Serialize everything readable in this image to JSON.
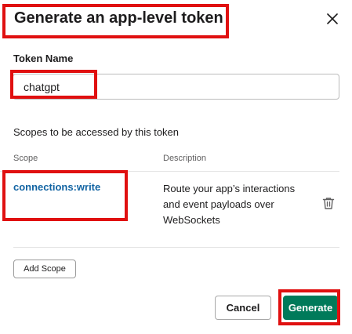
{
  "dialog": {
    "title": "Generate an app-level token",
    "close_icon": "close-icon"
  },
  "token": {
    "label": "Token Name",
    "value": "chatgpt"
  },
  "scopes": {
    "heading": "Scopes to be accessed by this token",
    "columns": {
      "scope": "Scope",
      "description": "Description"
    },
    "rows": [
      {
        "name": "connections:write",
        "description": "Route your app’s interactions and event payloads over WebSockets",
        "delete_icon": "trash-icon"
      }
    ],
    "add_label": "Add Scope"
  },
  "footer": {
    "cancel_label": "Cancel",
    "generate_label": "Generate"
  },
  "colors": {
    "primary": "#007a5a",
    "link": "#1264a3",
    "highlight": "#e01010"
  }
}
